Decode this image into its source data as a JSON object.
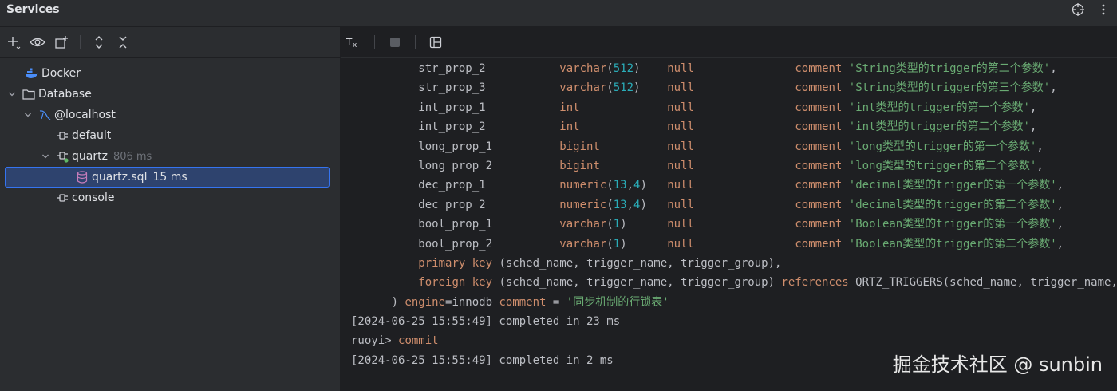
{
  "window": {
    "title": "Services"
  },
  "tree": [
    {
      "label": "Docker",
      "meta": "",
      "icon": "docker-icon"
    },
    {
      "label": "Database",
      "meta": "",
      "icon": "folder-icon"
    },
    {
      "label": "@localhost",
      "meta": "",
      "icon": "mysql-icon"
    },
    {
      "label": "default",
      "meta": "",
      "icon": "session-icon"
    },
    {
      "label": "quartz",
      "meta": "806 ms",
      "icon": "session-active-icon"
    },
    {
      "label": "quartz.sql",
      "meta": "15 ms",
      "icon": "sql-file-icon",
      "selected": true
    },
    {
      "label": "console",
      "meta": "",
      "icon": "session-icon"
    }
  ],
  "code_lines": [
    [
      [
        "ident",
        "          str_prop_2           "
      ],
      [
        "kw",
        "varchar"
      ],
      [
        "ident",
        "("
      ],
      [
        "num",
        "512"
      ],
      [
        "ident",
        ")    "
      ],
      [
        "kw",
        "null"
      ],
      [
        "ident",
        "               "
      ],
      [
        "kw",
        "comment "
      ],
      [
        "str",
        "'String类型的trigger的第二个参数'"
      ],
      [
        "ident",
        ","
      ]
    ],
    [
      [
        "ident",
        "          str_prop_3           "
      ],
      [
        "kw",
        "varchar"
      ],
      [
        "ident",
        "("
      ],
      [
        "num",
        "512"
      ],
      [
        "ident",
        ")    "
      ],
      [
        "kw",
        "null"
      ],
      [
        "ident",
        "               "
      ],
      [
        "kw",
        "comment "
      ],
      [
        "str",
        "'String类型的trigger的第三个参数'"
      ],
      [
        "ident",
        ","
      ]
    ],
    [
      [
        "ident",
        "          int_prop_1           "
      ],
      [
        "kw",
        "int"
      ],
      [
        "ident",
        "             "
      ],
      [
        "kw",
        "null"
      ],
      [
        "ident",
        "               "
      ],
      [
        "kw",
        "comment "
      ],
      [
        "str",
        "'int类型的trigger的第一个参数'"
      ],
      [
        "ident",
        ","
      ]
    ],
    [
      [
        "ident",
        "          int_prop_2           "
      ],
      [
        "kw",
        "int"
      ],
      [
        "ident",
        "             "
      ],
      [
        "kw",
        "null"
      ],
      [
        "ident",
        "               "
      ],
      [
        "kw",
        "comment "
      ],
      [
        "str",
        "'int类型的trigger的第二个参数'"
      ],
      [
        "ident",
        ","
      ]
    ],
    [
      [
        "ident",
        "          long_prop_1          "
      ],
      [
        "kw",
        "bigint"
      ],
      [
        "ident",
        "          "
      ],
      [
        "kw",
        "null"
      ],
      [
        "ident",
        "               "
      ],
      [
        "kw",
        "comment "
      ],
      [
        "str",
        "'long类型的trigger的第一个参数'"
      ],
      [
        "ident",
        ","
      ]
    ],
    [
      [
        "ident",
        "          long_prop_2          "
      ],
      [
        "kw",
        "bigint"
      ],
      [
        "ident",
        "          "
      ],
      [
        "kw",
        "null"
      ],
      [
        "ident",
        "               "
      ],
      [
        "kw",
        "comment "
      ],
      [
        "str",
        "'long类型的trigger的第二个参数'"
      ],
      [
        "ident",
        ","
      ]
    ],
    [
      [
        "ident",
        "          dec_prop_1           "
      ],
      [
        "kw",
        "numeric"
      ],
      [
        "ident",
        "("
      ],
      [
        "num",
        "13"
      ],
      [
        "ident",
        ","
      ],
      [
        "num",
        "4"
      ],
      [
        "ident",
        ")   "
      ],
      [
        "kw",
        "null"
      ],
      [
        "ident",
        "               "
      ],
      [
        "kw",
        "comment "
      ],
      [
        "str",
        "'decimal类型的trigger的第一个参数'"
      ],
      [
        "ident",
        ","
      ]
    ],
    [
      [
        "ident",
        "          dec_prop_2           "
      ],
      [
        "kw",
        "numeric"
      ],
      [
        "ident",
        "("
      ],
      [
        "num",
        "13"
      ],
      [
        "ident",
        ","
      ],
      [
        "num",
        "4"
      ],
      [
        "ident",
        ")   "
      ],
      [
        "kw",
        "null"
      ],
      [
        "ident",
        "               "
      ],
      [
        "kw",
        "comment "
      ],
      [
        "str",
        "'decimal类型的trigger的第二个参数'"
      ],
      [
        "ident",
        ","
      ]
    ],
    [
      [
        "ident",
        "          bool_prop_1          "
      ],
      [
        "kw",
        "varchar"
      ],
      [
        "ident",
        "("
      ],
      [
        "num",
        "1"
      ],
      [
        "ident",
        ")      "
      ],
      [
        "kw",
        "null"
      ],
      [
        "ident",
        "               "
      ],
      [
        "kw",
        "comment "
      ],
      [
        "str",
        "'Boolean类型的trigger的第一个参数'"
      ],
      [
        "ident",
        ","
      ]
    ],
    [
      [
        "ident",
        "          bool_prop_2          "
      ],
      [
        "kw",
        "varchar"
      ],
      [
        "ident",
        "("
      ],
      [
        "num",
        "1"
      ],
      [
        "ident",
        ")      "
      ],
      [
        "kw",
        "null"
      ],
      [
        "ident",
        "               "
      ],
      [
        "kw",
        "comment "
      ],
      [
        "str",
        "'Boolean类型的trigger的第二个参数'"
      ],
      [
        "ident",
        ","
      ]
    ],
    [
      [
        "ident",
        "          "
      ],
      [
        "kw",
        "primary key"
      ],
      [
        "ident",
        " (sched_name, trigger_name, trigger_group),"
      ]
    ],
    [
      [
        "ident",
        "          "
      ],
      [
        "kw",
        "foreign key"
      ],
      [
        "ident",
        " (sched_name, trigger_name, trigger_group) "
      ],
      [
        "kw",
        "references"
      ],
      [
        "ident",
        " QRTZ_TRIGGERS(sched_name, trigger_name, trigger_group)"
      ]
    ],
    [
      [
        "ident",
        "      ) "
      ],
      [
        "kw",
        "engine"
      ],
      [
        "ident",
        "=innodb "
      ],
      [
        "kw",
        "comment"
      ],
      [
        "ident",
        " = "
      ],
      [
        "str",
        "'同步机制的行锁表'"
      ]
    ],
    [
      [
        "ident",
        "[2024-06-25 15:55:49] completed in 23 ms"
      ]
    ],
    [
      [
        "ident",
        "ruoyi> "
      ],
      [
        "kw",
        "commit"
      ]
    ],
    [
      [
        "ident",
        "[2024-06-25 15:55:49] completed in 2 ms"
      ]
    ]
  ],
  "watermark": "掘金技术社区 @ sunbin"
}
